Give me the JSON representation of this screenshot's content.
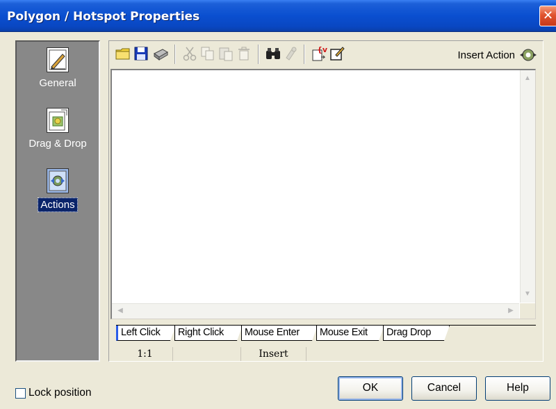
{
  "window": {
    "title": "Polygon / Hotspot Properties",
    "close_label": "✕"
  },
  "nav": {
    "items": [
      {
        "label": "General",
        "icon": "general-properties-icon",
        "selected": false
      },
      {
        "label": "Drag & Drop",
        "icon": "drag-drop-icon",
        "selected": false
      },
      {
        "label": "Actions",
        "icon": "actions-gear-icon",
        "selected": true
      }
    ]
  },
  "toolbar": {
    "insert_action_label": "Insert Action"
  },
  "tabs": [
    "Left Click",
    "Right Click",
    "Mouse Enter",
    "Mouse Exit",
    "Drag Drop"
  ],
  "status": {
    "position": "1:1",
    "mode": "Insert"
  },
  "footer": {
    "lock_label": "Lock position",
    "lock_checked": false,
    "ok_label": "OK",
    "cancel_label": "Cancel",
    "help_label": "Help"
  },
  "colors": {
    "titlebar": "#0a4fd0",
    "nav_bg": "#888888",
    "selected": "#0a246a",
    "close": "#e0532e"
  }
}
